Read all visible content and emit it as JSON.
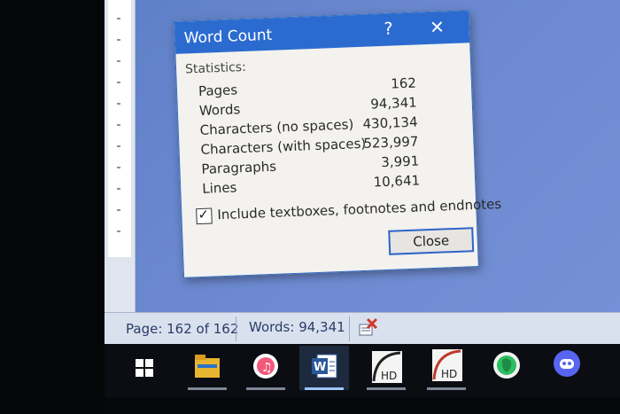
{
  "dialog": {
    "title": "Word Count",
    "help_glyph": "?",
    "close_glyph": "✕",
    "statistics_label": "Statistics:",
    "stats": [
      {
        "name": "Pages",
        "value": "162"
      },
      {
        "name": "Words",
        "value": "94,341"
      },
      {
        "name": "Characters (no spaces)",
        "value": "430,134"
      },
      {
        "name": "Characters (with spaces)",
        "value": "523,997"
      },
      {
        "name": "Paragraphs",
        "value": "3,991"
      },
      {
        "name": "Lines",
        "value": "10,641"
      }
    ],
    "include_checkbox": {
      "label": "Include textboxes, footnotes and endnotes",
      "checked": true,
      "mark": "✓"
    },
    "close_button_label": "Close"
  },
  "statusbar": {
    "page": "Page: 162 of 162",
    "words": "Words: 94,341"
  },
  "taskbar": {
    "items": [
      {
        "icon": "windows-start-icon"
      },
      {
        "icon": "file-explorer-icon"
      },
      {
        "icon": "itunes-icon"
      },
      {
        "icon": "word-icon",
        "active": true
      },
      {
        "icon": "hd-app-icon"
      },
      {
        "icon": "hd-app-icon"
      },
      {
        "icon": "evernote-icon"
      },
      {
        "icon": "discord-icon"
      }
    ]
  },
  "colors": {
    "title_bar": "#2b6bd0",
    "workspace": "#6b88cf",
    "statusbar": "#d9e1ef",
    "taskbar": "#0b0d12"
  }
}
